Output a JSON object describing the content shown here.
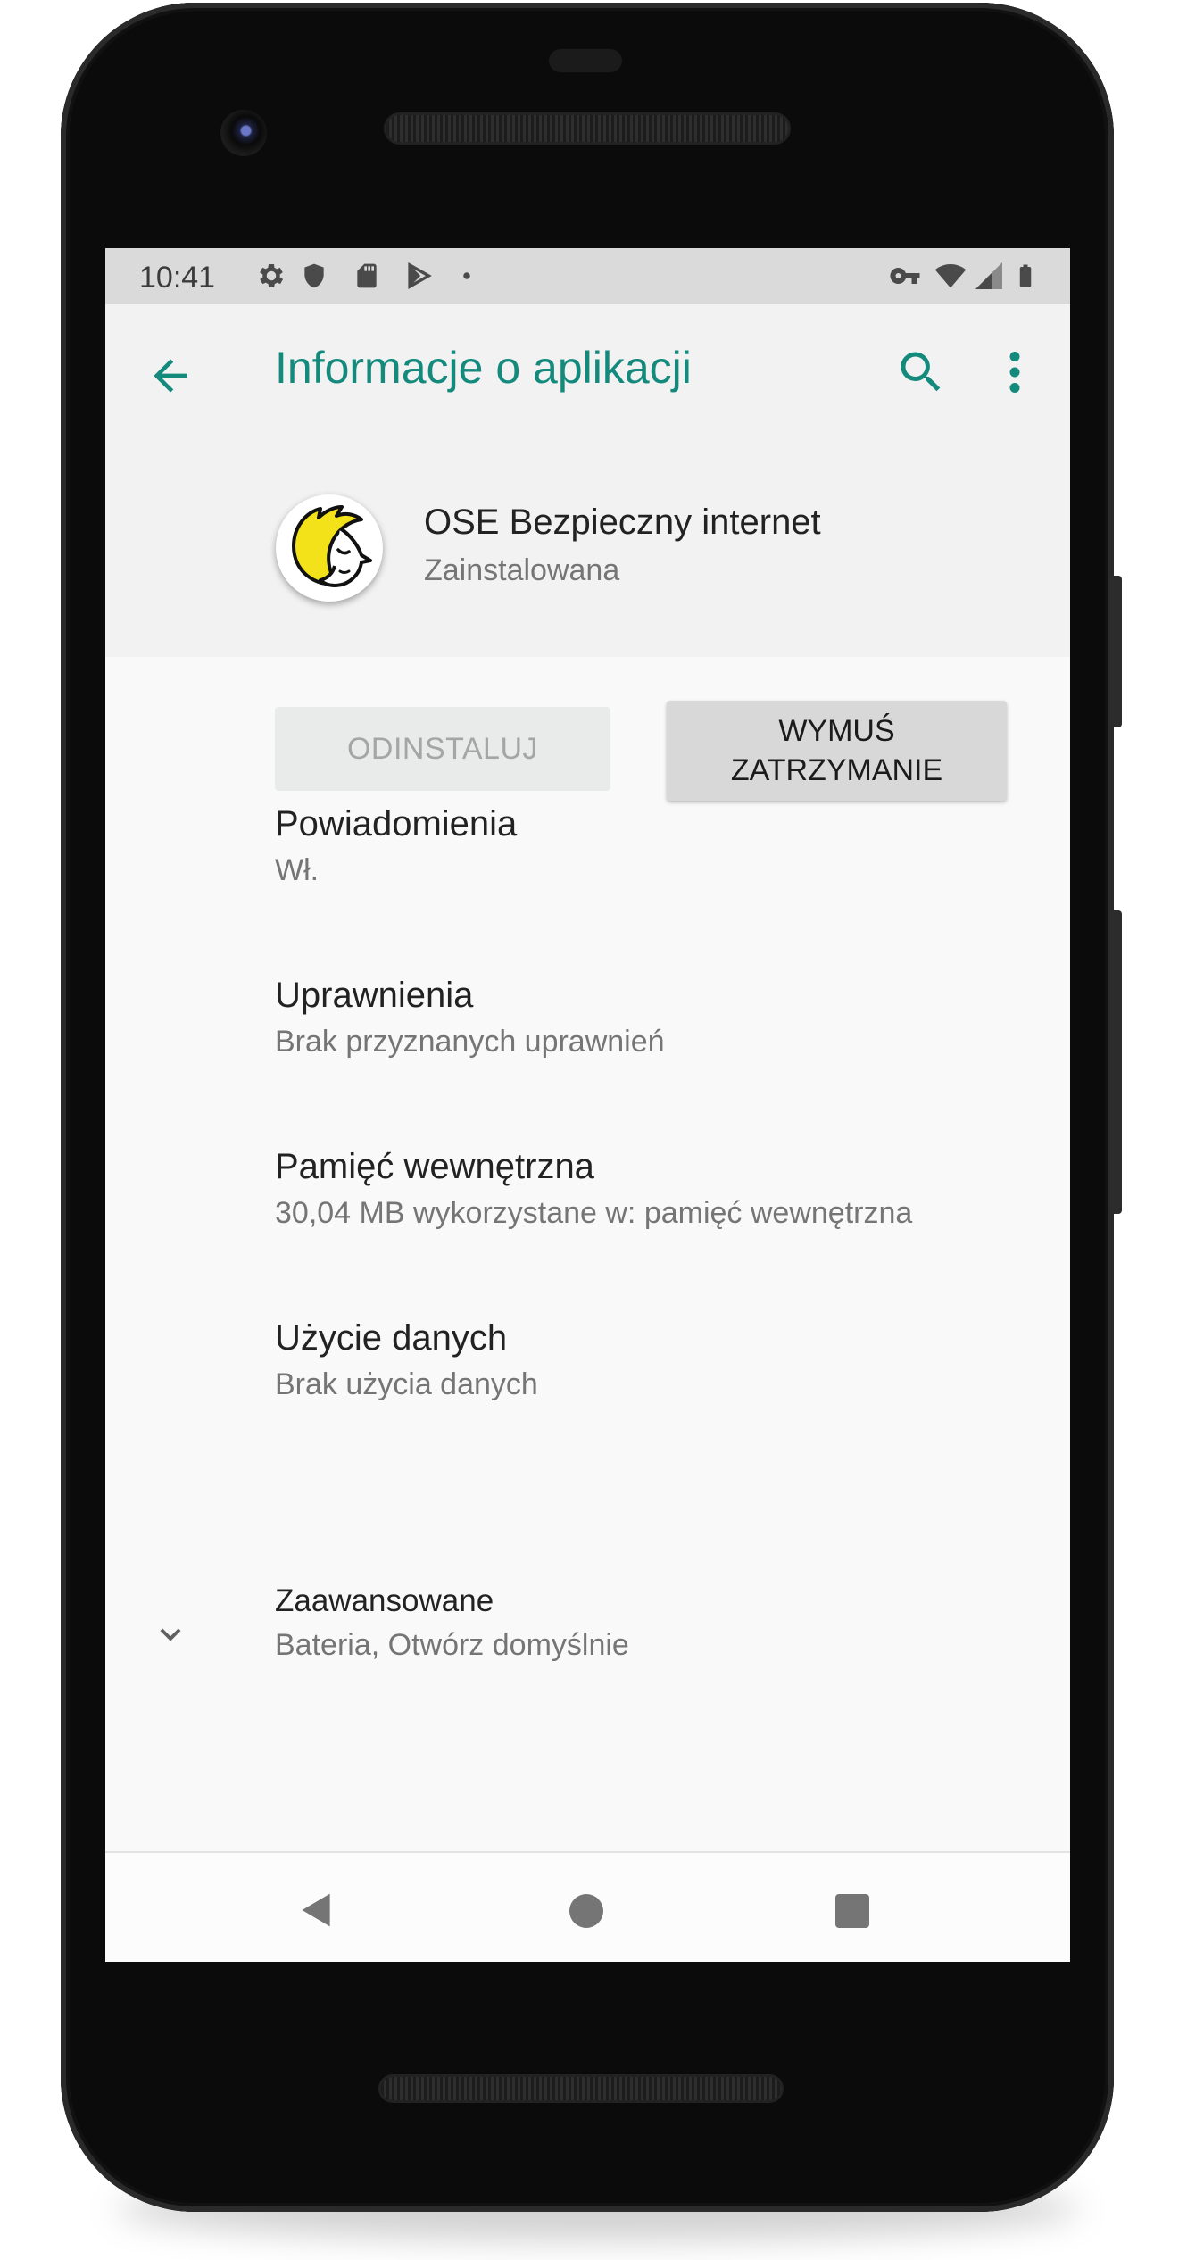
{
  "status_bar": {
    "time": "10:41",
    "left_icons": [
      "gear-icon",
      "shield-icon",
      "sd-card-icon",
      "play-store-icon",
      "dot-icon"
    ],
    "right_icons": [
      "vpn-key-icon",
      "wifi-icon",
      "signal-icon",
      "battery-icon"
    ]
  },
  "app_bar": {
    "title": "Informacje o aplikacji",
    "back_icon": "arrow-left-icon",
    "search_icon": "search-icon",
    "more_icon": "more-vert-icon"
  },
  "app": {
    "name": "OSE Bezpieczny internet",
    "status": "Zainstalowana"
  },
  "buttons": {
    "uninstall": "ODINSTALUJ",
    "force_stop": "WYMUŚ\nZATRZYMANIE"
  },
  "settings": [
    {
      "title": "Powiadomienia",
      "subtitle": "Wł."
    },
    {
      "title": "Uprawnienia",
      "subtitle": "Brak przyznanych uprawnień"
    },
    {
      "title": "Pamięć wewnętrzna",
      "subtitle": "30,04 MB wykorzystane w: pamięć wewnętrzna"
    },
    {
      "title": "Użycie danych",
      "subtitle": "Brak użycia danych"
    }
  ],
  "advanced": {
    "title": "Zaawansowane",
    "subtitle": "Bateria, Otwórz domyślnie",
    "icon": "chevron-down-icon"
  },
  "nav_bar": {
    "icons": [
      "nav-back-icon",
      "nav-home-icon",
      "nav-recents-icon"
    ]
  },
  "colors": {
    "accent": "#138a7c",
    "status_bar": "#dadada",
    "header_bg": "#f2f2f2",
    "content_bg": "#f9f9f9"
  }
}
